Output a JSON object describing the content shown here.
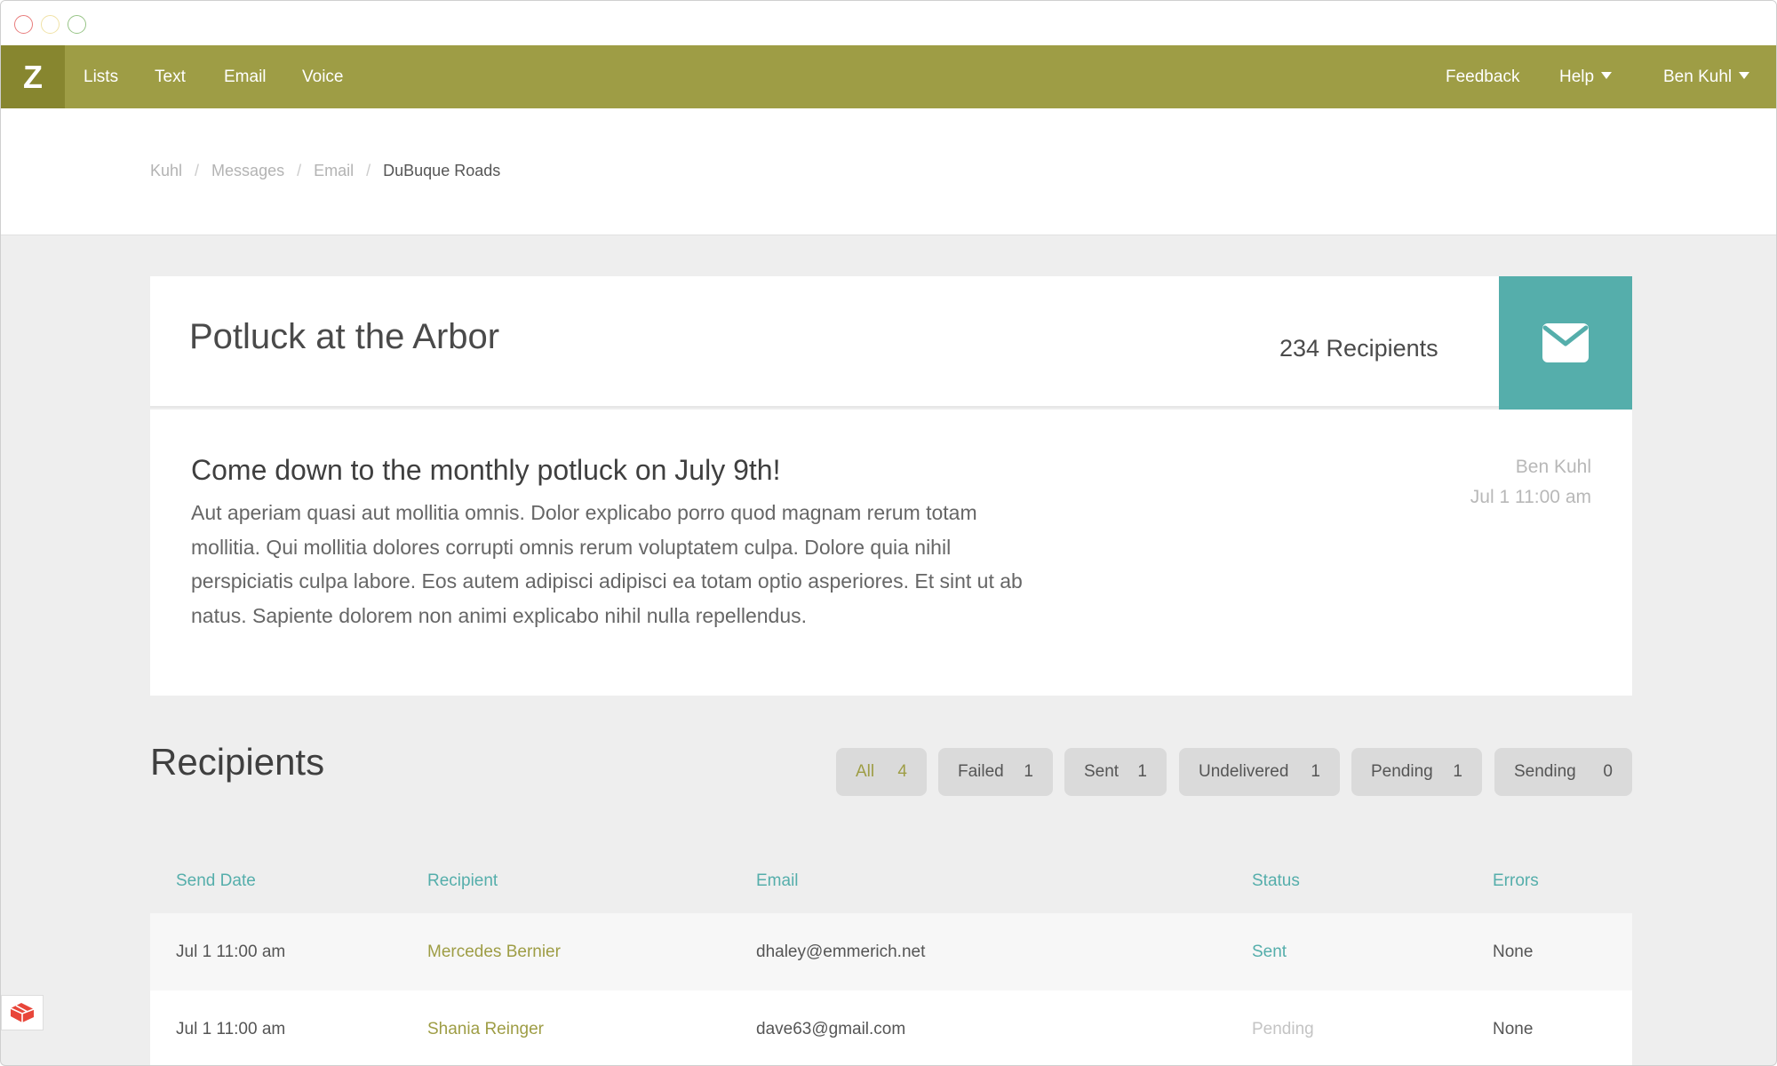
{
  "nav": {
    "logo": "Z",
    "items": [
      "Lists",
      "Text",
      "Email",
      "Voice"
    ],
    "feedback": "Feedback",
    "help": "Help",
    "user": "Ben Kuhl",
    "bar_color": "#9e9d45"
  },
  "breadcrumb": [
    "Kuhl",
    "Messages",
    "Email",
    "DuBuque Roads"
  ],
  "message": {
    "title": "Potluck at the Arbor",
    "recipients_count": "234 Recipients",
    "subject": "Come down to the monthly potluck on July 9th!",
    "body": "Aut aperiam quasi aut mollitia omnis. Dolor explicabo porro quod magnam rerum totam mollitia. Qui mollitia dolores corrupti omnis rerum voluptatem culpa. Dolore quia nihil perspiciatis culpa labore. Eos autem adipisci adipisci ea totam optio asperiores. Et sint ut ab natus. Sapiente dolorem non animi explicabo nihil nulla repellendus.",
    "author": "Ben Kuhl",
    "date": "Jul 1 11:00 am",
    "icon": "envelope-icon",
    "accent": "#55aeab"
  },
  "recipients": {
    "title": "Recipients",
    "filters": [
      {
        "label": "All",
        "count": "4"
      },
      {
        "label": "Failed",
        "count": "1"
      },
      {
        "label": "Sent",
        "count": "1"
      },
      {
        "label": "Undelivered",
        "count": "1"
      },
      {
        "label": "Pending",
        "count": "1"
      },
      {
        "label": "Sending",
        "count": "0"
      }
    ],
    "columns": [
      "Send Date",
      "Recipient",
      "Email",
      "Status",
      "Errors"
    ],
    "rows": [
      {
        "date": "Jul 1 11:00 am",
        "name": "Mercedes Bernier",
        "email": "dhaley@emmerich.net",
        "status": "Sent",
        "errors": "None"
      },
      {
        "date": "Jul 1 11:00 am",
        "name": "Shania Reinger",
        "email": "dave63@gmail.com",
        "status": "Pending",
        "errors": "None"
      }
    ]
  }
}
